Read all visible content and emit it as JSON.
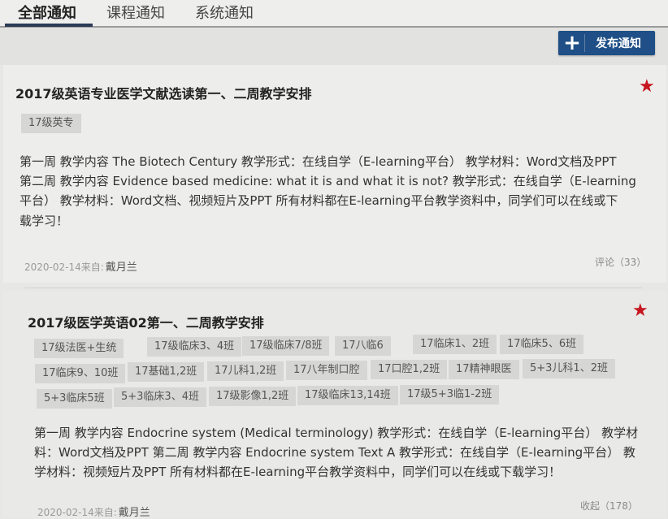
{
  "tabs": [
    {
      "label": "全部通知",
      "active": true
    },
    {
      "label": "课程通知",
      "active": false
    },
    {
      "label": "系统通知",
      "active": false
    }
  ],
  "publish_button": {
    "icon": "plus-icon",
    "label": "发布通知"
  },
  "accent_color": "#1f4f86",
  "star_color": "#c6161f",
  "notices": [
    {
      "title": "2017级英语专业医学文献选读第一、二周教学安排",
      "starred": true,
      "tags": [
        "17级英专"
      ],
      "body_lines": [
        "第一周 教学内容 The Biotech Century 教学形式：在线自学（E-learning平台） 教学材料：Word文档及PPT",
        "第二周 教学内容 Evidence based medicine: what it is and what it is not? 教学形式：在线自学（E-learning",
        "平台） 教学材料：Word文档、视频短片及PPT 所有材料都在E-learning平台教学资料中，同学们可以在线或下",
        "载学习！"
      ],
      "date_source": "2020-02-14来自:",
      "author": "戴月兰",
      "action": "评论（33）"
    },
    {
      "title": "2017级医学英语02第一、二周教学安排",
      "starred": true,
      "tags": [
        "17级法医+生统",
        "17级临床3、4班",
        "17级临床7/8班",
        "17八临6",
        "17临床1、2班",
        "17临床5、6班",
        "17临床9、10班",
        "17基础1,2班",
        "17儿科1,2班",
        "17八年制口腔",
        "17口腔1,2班",
        "17精神眼医",
        "5+3儿科1、2班",
        "5+3临床5班",
        "5+3临床3、4班",
        "17级影像1,2班",
        "17级临床13,14班",
        "17级5+3临1-2班"
      ],
      "body_lines": [
        "第一周 教学内容 Endocrine system (Medical terminology) 教学形式：在线自学（E-learning平台） 教学材",
        "料：Word文档及PPT 第二周 教学内容 Endocrine system Text A 教学形式：在线自学（E-learning平台） 教",
        "学材料：视频短片及PPT 所有材料都在E-learning平台教学资料中，同学们可以在线或下载学习！"
      ],
      "date_source": "2020-02-14来自:",
      "author": "戴月兰",
      "action": "收起（178）"
    }
  ]
}
